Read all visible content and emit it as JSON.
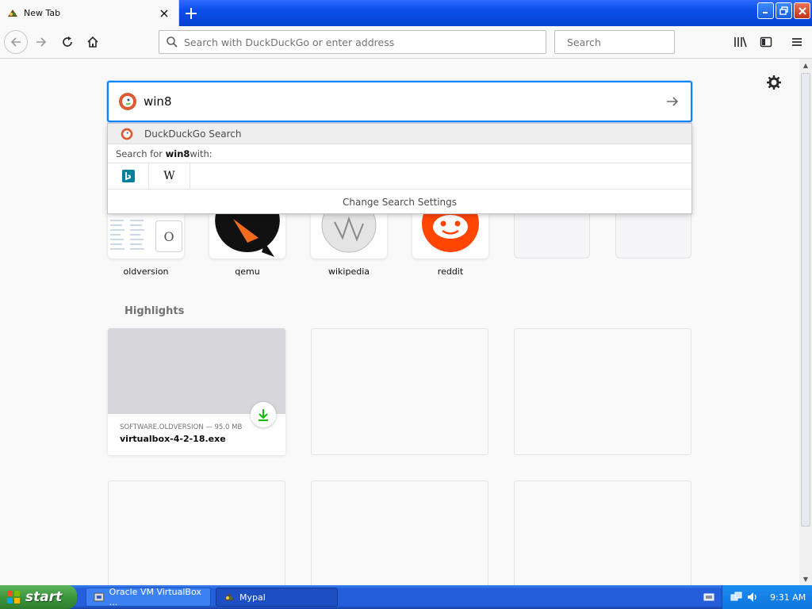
{
  "tab": {
    "title": "New Tab",
    "close_label": "×",
    "new_tab_label": "+"
  },
  "window_controls": {
    "minimize": "_",
    "restore": "❐",
    "close": "✕"
  },
  "navbar": {
    "url_placeholder": "Search with DuckDuckGo or enter address",
    "search_placeholder": "Search"
  },
  "search": {
    "value": "win8",
    "engine_label": "DuckDuckGo Search",
    "search_for_prefix": "Search for ",
    "search_for_term": "win8",
    "search_for_suffix": " with:",
    "engines": [
      "bing",
      "wikipedia"
    ],
    "wiki_glyph": "W",
    "settings_label": "Change Search Settings"
  },
  "top_sites": [
    {
      "name": "oldversion"
    },
    {
      "name": "qemu"
    },
    {
      "name": "wikipedia"
    },
    {
      "name": "reddit"
    },
    {
      "name": ""
    },
    {
      "name": ""
    }
  ],
  "oldversion_badge": "O",
  "highlights": {
    "title": "Highlights",
    "card": {
      "meta": "SOFTWARE.OLDVERSION — 95.0 MB",
      "filename": "virtualbox-4-2-18.exe"
    }
  },
  "taskbar": {
    "start_label": "start",
    "tasks": [
      "Oracle VM VirtualBox ...",
      "Mypal"
    ],
    "clock": "9:31 AM"
  },
  "colors": {
    "accent": "#0a84ff",
    "ddg": "#de5833",
    "reddit": "#ff4500",
    "taskbar": "#245edb",
    "start": "#3c963c"
  }
}
